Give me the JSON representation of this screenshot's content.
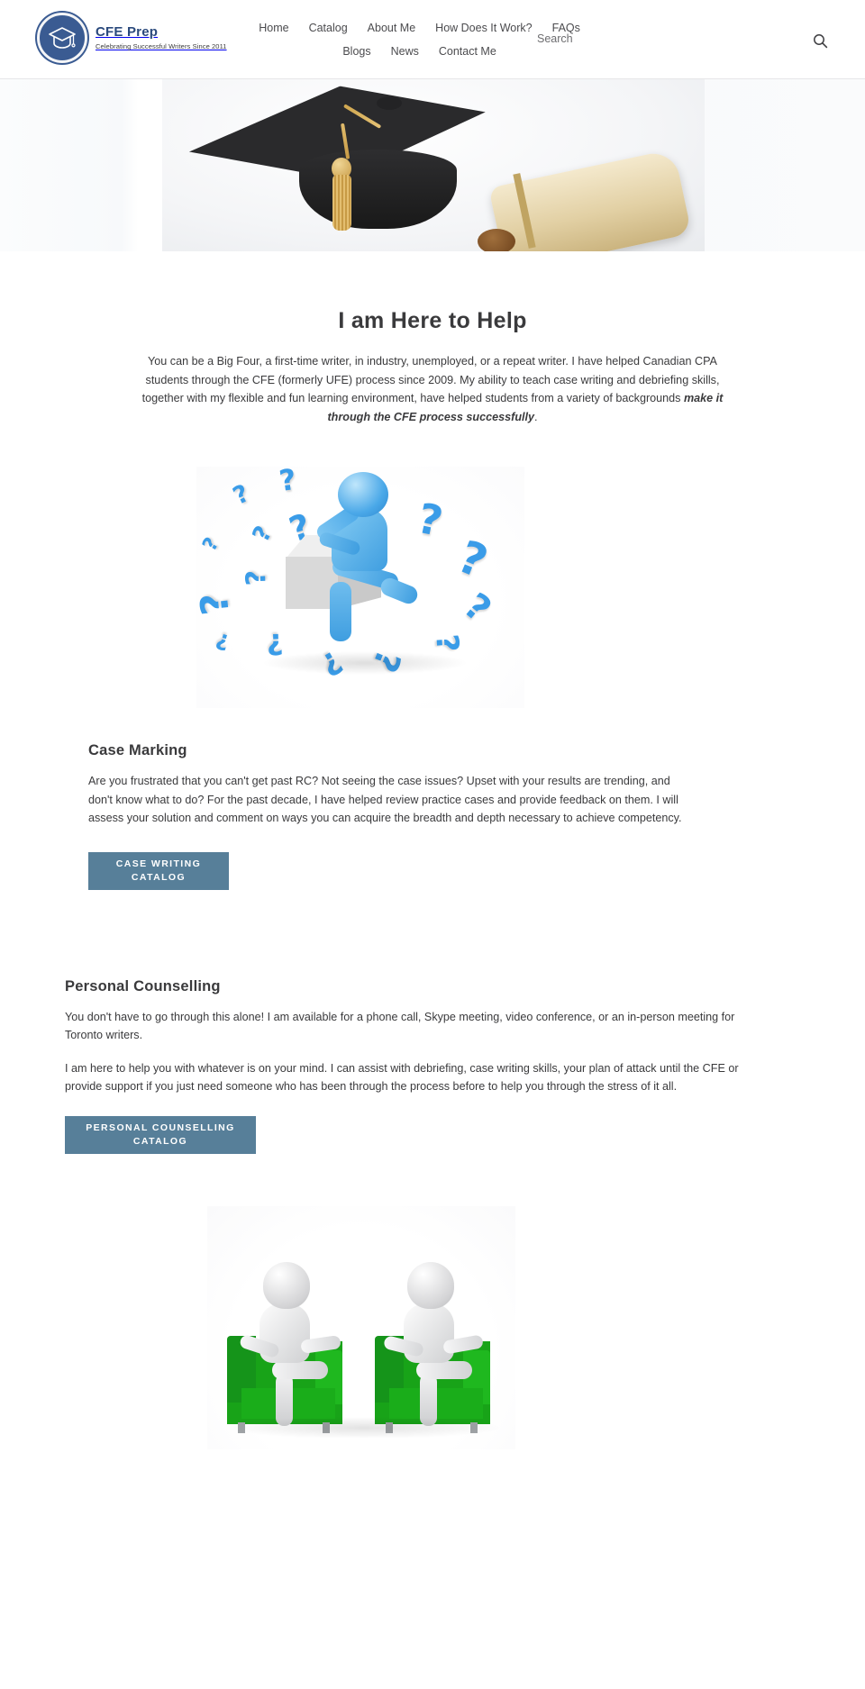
{
  "header": {
    "brand": {
      "name": "CFE Prep",
      "tagline": "Celebrating Successful Writers Since 2011",
      "logo_icon": "graduation-cap-icon",
      "logo_color": "#3a5b92"
    },
    "nav": [
      {
        "label": "Home"
      },
      {
        "label": "Catalog"
      },
      {
        "label": "About Me"
      },
      {
        "label": "How Does It Work?"
      },
      {
        "label": "FAQs"
      },
      {
        "label": "Blogs"
      },
      {
        "label": "News"
      },
      {
        "label": "Contact Me"
      }
    ],
    "search": {
      "label": "Search",
      "icon": "search-icon"
    }
  },
  "hero": {
    "image_alt": "graduation-cap-and-diploma-image"
  },
  "intro": {
    "title": "I am Here to Help",
    "body_part1": "You can be a Big Four, a first-time writer, in industry, unemployed, or a repeat writer. I have helped Canadian CPA students through the CFE (formerly UFE) process since 2009. My ability to teach case writing and debriefing skills, together with my flexible and fun learning environment, have helped students from a variety of backgrounds ",
    "body_emphasis": "make it through the CFE process successfully",
    "body_part2": "."
  },
  "illustrations": {
    "question_marks_alt": "thinking-person-with-question-marks-image",
    "counselling_alt": "two-people-in-green-chairs-image",
    "question_mark_glyph": "?"
  },
  "services": [
    {
      "heading": "Case Marking",
      "body": "Are you frustrated that you can't get past RC? Not seeing the case issues? Upset with your results are trending, and don't know what to do? For the past decade, I have helped review practice cases and provide feedback on them. I will assess your solution and comment on ways you can acquire the breadth and depth necessary to achieve competency.",
      "cta_line1": "CASE WRITING",
      "cta_line2": "CATALOG"
    },
    {
      "heading": "Personal Counselling",
      "body1": "You don't have to go through this alone! I am available for a phone call, Skype meeting, video conference, or an in-person meeting for Toronto writers.",
      "body2": "I am here to help you with whatever is on your mind. I can assist with debriefing, case writing skills, your plan of attack until the CFE or provide support if you just need someone who has been through the process before to help you through the stress of it all.",
      "cta_line1": "PERSONAL COUNSELLING",
      "cta_line2": "CATALOG"
    }
  ],
  "colors": {
    "brand_blue": "#2b4a7d",
    "button_slate": "#577f99",
    "text_dark": "#3a3a3c",
    "nav_text": "#4b4b4e"
  }
}
